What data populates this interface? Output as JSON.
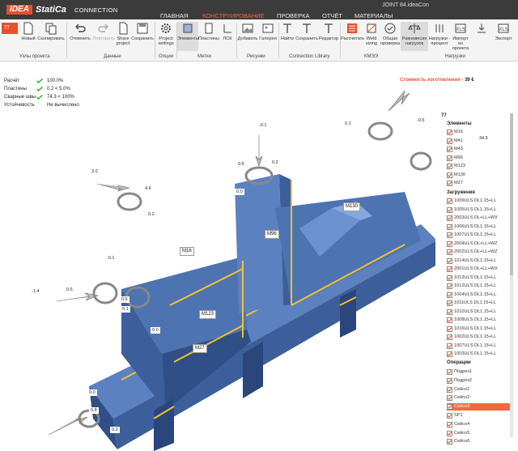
{
  "app": {
    "logo_brand": "IDEA",
    "logo_product": "StatiCa",
    "logo_module": "CONNECTION",
    "document_title": "JOINT 84.ideaCon"
  },
  "menu": {
    "tabs": [
      "ГЛАВНАЯ",
      "КОНСТРУИРОВАНИЕ",
      "ПРОВЕРКА",
      "ОТЧЁТ",
      "МАТЕРИАЛЫ"
    ],
    "active_index": 1
  },
  "ribbon": {
    "project_selector": "77",
    "buttons": {
      "new": "Новый",
      "copy": "Скопировать",
      "undo": "Отменить",
      "redo": "Повторить",
      "share": "Share project",
      "save": "Сохранить",
      "project_settings": "Project settings",
      "elements": "Элементы",
      "plates": "Пластины",
      "lcs": "ЛСК",
      "add": "Добавить",
      "gallery": "Галерея",
      "find": "Найти",
      "save_lib": "Сохранить",
      "editor": "Редактор",
      "calculate": "Рассчитать",
      "weld_sizing": "Weld sizing",
      "overall_check": "Общая проверка",
      "equilibrium": "Равновесие нагрузок",
      "loads_percent": "Нагрузки - процент",
      "import_xls": "Импорт из проекта",
      "export_xls": "Экспорт"
    },
    "groups": {
      "project_nodes": "Узлы проекта",
      "data": "Данные",
      "options": "Опции",
      "labels": "Метки",
      "pictures": "Рисунки",
      "connection_library": "Connection Library",
      "kmse": "КМЭЭ",
      "loads": "Нагрузки"
    }
  },
  "results": {
    "rows": [
      {
        "label": "Расчёт",
        "value": "100.0%",
        "ok": true
      },
      {
        "label": "Пластины",
        "value": "0.2 < 5.0%",
        "ok": true
      },
      {
        "label": "Сварные швы",
        "value": "74.3 < 100%",
        "ok": true
      },
      {
        "label": "Устойчивость",
        "value": "Не вычислено",
        "ok": false
      }
    ],
    "cost_label": "Стоимость изготовления",
    "cost_value": "39 €"
  },
  "tree": {
    "root": "77",
    "elements_title": "Элементы",
    "elements": [
      "M16",
      "M41",
      "M43",
      "M96",
      "M123",
      "M130",
      "M27"
    ],
    "loads_title": "Загружения",
    "loads": [
      "1009ULS DL1.15+LL",
      "1005ULS DL1.15+LL",
      "2003ULS DL+LL+WX",
      "1006ULS DL1.15+LL",
      "1007ULS DL1.15+LL",
      "2004ULS DL+LL+WZ",
      "2002ULS DL+LL+WZ",
      "1014ULS DL1.15+LL",
      "2001ULS DL+LL+WX",
      "1013ULS DL1.15+LL",
      "1012ULS DL1.15+LL",
      "1004ULS DL1.15+LL",
      "1011ULS DL1.15+LL",
      "1010ULS DL1.15+LL",
      "1008ULS DL1.15+LL",
      "1016ULS DL1.15+LL",
      "1002ULS DL1.15+LL",
      "1007ULS DL1.15+LL",
      "1003ULS DL1.15+LL"
    ],
    "ops_title": "Операции",
    "operations": [
      "Подрез1",
      "Подрез2",
      "Сейсо1",
      "Сейсо2",
      "Сейсо3",
      "SP1",
      "Сейсо4",
      "Сейсо5",
      "Сейсо6"
    ],
    "highlighted_operation": "Сейсо3"
  },
  "viewport": {
    "member_labels": [
      "M16",
      "M96",
      "M130",
      "M123",
      "M27"
    ],
    "load_values": [
      "0.1",
      "34.5",
      "-0.1",
      "0.2",
      "0.5",
      "0.0",
      "4.6",
      "3.0",
      "0.2",
      "-0.1",
      "-1.4",
      "0.6",
      "0.5",
      "0.1",
      "-0.5",
      "0.0",
      "0.8",
      "0.2",
      "0.0"
    ],
    "colors": {
      "steel": "#4d73b1",
      "steel_dark": "#2f4f86",
      "weld": "#f2c230",
      "accent": "#e8502d"
    }
  }
}
